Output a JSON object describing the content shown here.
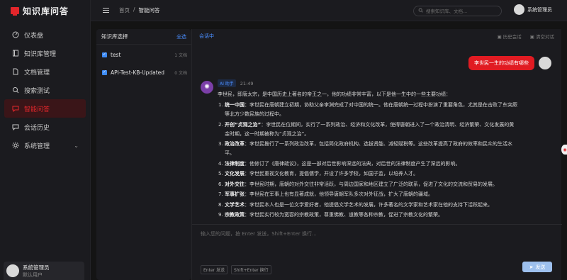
{
  "app": {
    "title": "知识库问答"
  },
  "sidebar": {
    "items": [
      {
        "label": "仪表盘",
        "icon": "dashboard-icon"
      },
      {
        "label": "知识库管理",
        "icon": "book-icon"
      },
      {
        "label": "文档管理",
        "icon": "document-icon"
      },
      {
        "label": "搜索测试",
        "icon": "search-icon"
      },
      {
        "label": "智能问答",
        "icon": "chat-icon",
        "active": true
      },
      {
        "label": "会话历史",
        "icon": "history-icon"
      },
      {
        "label": "系统管理",
        "icon": "gear-icon"
      }
    ],
    "user": {
      "name": "系统管理员",
      "role": "默认用户"
    }
  },
  "topbar": {
    "breadcrumb": [
      "首页",
      "/",
      "智能问答"
    ],
    "search_placeholder": "搜索知识库、文档...",
    "user_name": "系统管理员"
  },
  "kb_panel": {
    "title": "知识库选择",
    "select_all": "全选",
    "items": [
      {
        "name": "test",
        "count": "1 文档",
        "checked": true
      },
      {
        "name": "API-Test-KB-Updated",
        "count": "0 文档",
        "checked": true
      }
    ]
  },
  "chat": {
    "status": "会话中",
    "history_label": "历史会话",
    "clear_label": "清空对话",
    "user_message": "李世民一生的功绩有哪些",
    "ai_badge": "AI 助手",
    "ai_time": "21:49",
    "ai_intro": "李世民，即唐太宗，是中国历史上著名的帝王之一，他的功绩非常丰富，以下是他一生中的一些主要功绩：",
    "ai_points": [
      {
        "title": "统一中国",
        "text": "：李世民在唐朝建立初期，协助父亲李渊完成了对中国的统一。他在唐朝统一过程中扮演了重要角色，尤其是在击败了东突厥等北方少数民族的过程中。"
      },
      {
        "title": "开创“贞观之治”",
        "text": "：李世民在位期间，实行了一系列政治、经济和文化改革，使得唐朝进入了一个政治清明、经济繁荣、文化发展的黄金时期，这一时期被称为“贞观之治”。"
      },
      {
        "title": "政治改革",
        "text": "：李世民推行了一系列政治改革，包括简化政府机构、选拔贤能、减轻赋税等。这些改革提高了政府的效率和民众的生活水平。"
      },
      {
        "title": "法律制度",
        "text": "：他修订了《唐律疏议》，这是一部对后世影响深远的法典，对后世的法律制度产生了深远的影响。"
      },
      {
        "title": "文化发展",
        "text": "：李世民重视文化教育，提倡儒学，开设了许多学校，如国子监，以培养人才。"
      },
      {
        "title": "对外交往",
        "text": "：李世民时期，唐朝的对外交往非常活跃，与周边国家和地区建立了广泛的联系，促进了文化的交流和贸易的发展。"
      },
      {
        "title": "军事扩张",
        "text": "：李世民在军事上也有显著成就，他领导唐朝军队多次对外征战，扩大了唐朝的疆域。"
      },
      {
        "title": "文学艺术",
        "text": "：李世民本人也是一位文学爱好者，他提倡文学艺术的发展，许多著名的文学家和艺术家在他的支持下活跃起来。"
      },
      {
        "title": "宗教政策",
        "text": "：李世民实行较为宽容的宗教政策，尊重佛教、道教等各种宗教，促进了宗教文化的繁荣。"
      }
    ],
    "input_placeholder": "输入您的问题，按 Enter 发送，Shift+Enter 换行...",
    "hint_enter": "Enter 发送",
    "hint_shift": "Shift+Enter 换行",
    "send_label": "发送"
  },
  "colors": {
    "accent": "#e11b22",
    "link": "#4a8eff",
    "bg": "#141414"
  }
}
